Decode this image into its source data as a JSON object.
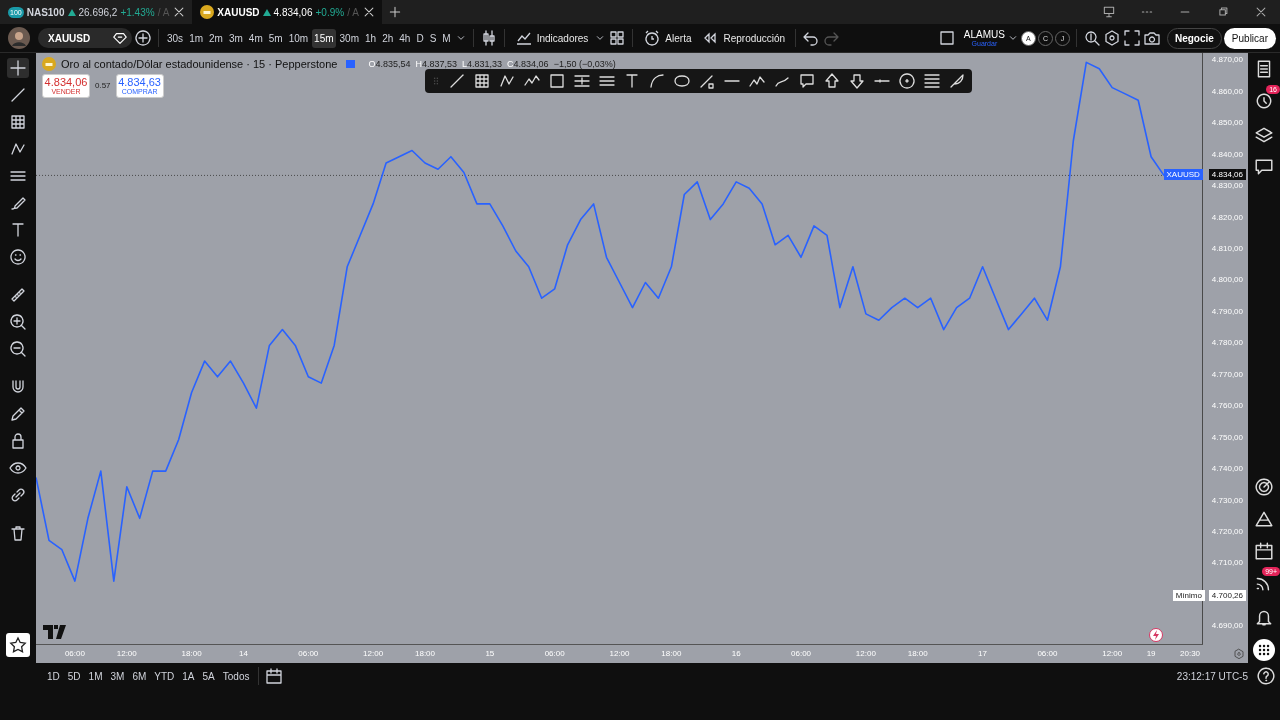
{
  "tabs": [
    {
      "badge": "100",
      "symbol": "NAS100",
      "price": "26.696,2",
      "change": "+1.43%",
      "extra": "/ A",
      "selected": false
    },
    {
      "symbol": "XAUUSD",
      "price": "4.834,06",
      "change": "+0.9%",
      "extra": "/ A",
      "selected": true
    }
  ],
  "toolbar": {
    "symbol": "XAUUSD",
    "intervals": [
      {
        "label": "30s",
        "selected": false
      },
      {
        "label": "1m",
        "selected": false
      },
      {
        "label": "2m",
        "selected": false
      },
      {
        "label": "3m",
        "selected": false
      },
      {
        "label": "4m",
        "selected": false
      },
      {
        "label": "5m",
        "selected": false
      },
      {
        "label": "10m",
        "selected": false
      },
      {
        "label": "15m",
        "selected": true
      },
      {
        "label": "30m",
        "selected": false
      },
      {
        "label": "1h",
        "selected": false
      },
      {
        "label": "2h",
        "selected": false
      },
      {
        "label": "4h",
        "selected": false
      },
      {
        "label": "D",
        "selected": false
      },
      {
        "label": "S",
        "selected": false
      },
      {
        "label": "M",
        "selected": false
      }
    ],
    "indicators": "Indicadores",
    "alert": "Alerta",
    "replay": "Reproducción",
    "layout_name": "ALAMUS",
    "layout_save": "Guardar",
    "circles": [
      "A",
      "C",
      "J"
    ],
    "trade": "Negocie",
    "publish": "Publicar"
  },
  "legend": {
    "title": "Oro al contado/Dólar estadounidense · 15 · Pepperstone",
    "ohlc": [
      {
        "key": "O",
        "value": "4.835,54"
      },
      {
        "key": "H",
        "value": "4.837,53"
      },
      {
        "key": "L",
        "value": "4.831,33"
      },
      {
        "key": "C",
        "value": "4.834,06"
      }
    ],
    "change": "−1,50 (−0,03%)",
    "sell": {
      "price": "4.834,06",
      "label": "VENDER"
    },
    "spread": "0.57",
    "buy": {
      "price": "4.834,63",
      "label": "COMPRAR"
    }
  },
  "chart_data": {
    "type": "line",
    "series": [
      {
        "name": "XAUUSD",
        "color": "#2962ff",
        "values": [
          4738,
          4718,
          4715,
          4705,
          4725,
          4740,
          4705,
          4735,
          4725,
          4740,
          4740,
          4750,
          4765,
          4775,
          4770,
          4775,
          4768,
          4760,
          4780,
          4785,
          4780,
          4770,
          4768,
          4780,
          4805,
          4815,
          4825,
          4838,
          4840,
          4842,
          4838,
          4836,
          4840,
          4835,
          4825,
          4825,
          4818,
          4810,
          4805,
          4795,
          4798,
          4812,
          4820,
          4825,
          4808,
          4800,
          4792,
          4800,
          4795,
          4805,
          4828,
          4832,
          4820,
          4825,
          4832,
          4830,
          4825,
          4812,
          4815,
          4808,
          4818,
          4815,
          4792,
          4805,
          4790,
          4788,
          4792,
          4795,
          4792,
          4795,
          4785,
          4792,
          4795,
          4805,
          4795,
          4785,
          4790,
          4795,
          4788,
          4805,
          4845,
          4870,
          4868,
          4862,
          4860,
          4858,
          4840,
          4834,
          null,
          null
        ]
      }
    ],
    "categories": [
      null,
      null,
      null,
      "06:00",
      null,
      null,
      null,
      "12:00",
      null,
      null,
      null,
      null,
      "18:00",
      null,
      null,
      null,
      "14",
      null,
      null,
      null,
      null,
      "06:00",
      null,
      null,
      null,
      null,
      "12:00",
      null,
      null,
      null,
      "18:00",
      null,
      null,
      null,
      null,
      "15",
      null,
      null,
      null,
      null,
      "06:00",
      null,
      null,
      null,
      null,
      "12:00",
      null,
      null,
      null,
      "18:00",
      null,
      null,
      null,
      null,
      "16",
      null,
      null,
      null,
      null,
      "06:00",
      null,
      null,
      null,
      null,
      "12:00",
      null,
      null,
      null,
      "18:00",
      null,
      null,
      null,
      null,
      "17",
      null,
      null,
      null,
      null,
      "06:00",
      null,
      null,
      null,
      null,
      "12:00",
      null,
      null,
      "19",
      null,
      null,
      "20:30"
    ],
    "ylim": [
      4685,
      4873
    ],
    "ref_lines": [
      {
        "axis": "y",
        "value": 4834.06
      }
    ],
    "yticks": [
      {
        "value": 4690,
        "label": "4.690,00"
      },
      {
        "value": 4710,
        "label": "4.710,00"
      },
      {
        "value": 4720,
        "label": "4.720,00"
      },
      {
        "value": 4730,
        "label": "4.730,00"
      },
      {
        "value": 4740,
        "label": "4.740,00"
      },
      {
        "value": 4750,
        "label": "4.750,00"
      },
      {
        "value": 4760,
        "label": "4.760,00"
      },
      {
        "value": 4770,
        "label": "4.770,00"
      },
      {
        "value": 4780,
        "label": "4.780,00"
      },
      {
        "value": 4790,
        "label": "4.790,00"
      },
      {
        "value": 4800,
        "label": "4.800,00"
      },
      {
        "value": 4810,
        "label": "4.810,00"
      },
      {
        "value": 4820,
        "label": "4.820,00"
      },
      {
        "value": 4830,
        "label": "4.830,00"
      },
      {
        "value": 4840,
        "label": "4.840,00"
      },
      {
        "value": 4850,
        "label": "4.850,00"
      },
      {
        "value": 4860,
        "label": "4.860,00"
      },
      {
        "value": 4870,
        "label": "4.870,00"
      }
    ]
  },
  "price_labels": [
    {
      "kind": "current",
      "price": "4.834,06"
    },
    {
      "kind": "minimum",
      "name": "Mínimo",
      "price": "4.700,26"
    }
  ],
  "sidebar_badges": {
    "alerts": "16",
    "feed": "99+"
  },
  "ranges": [
    "1D",
    "5D",
    "1M",
    "3M",
    "6M",
    "YTD",
    "1A",
    "5A",
    "Todos"
  ],
  "clock": "23:12:17 UTC-5"
}
